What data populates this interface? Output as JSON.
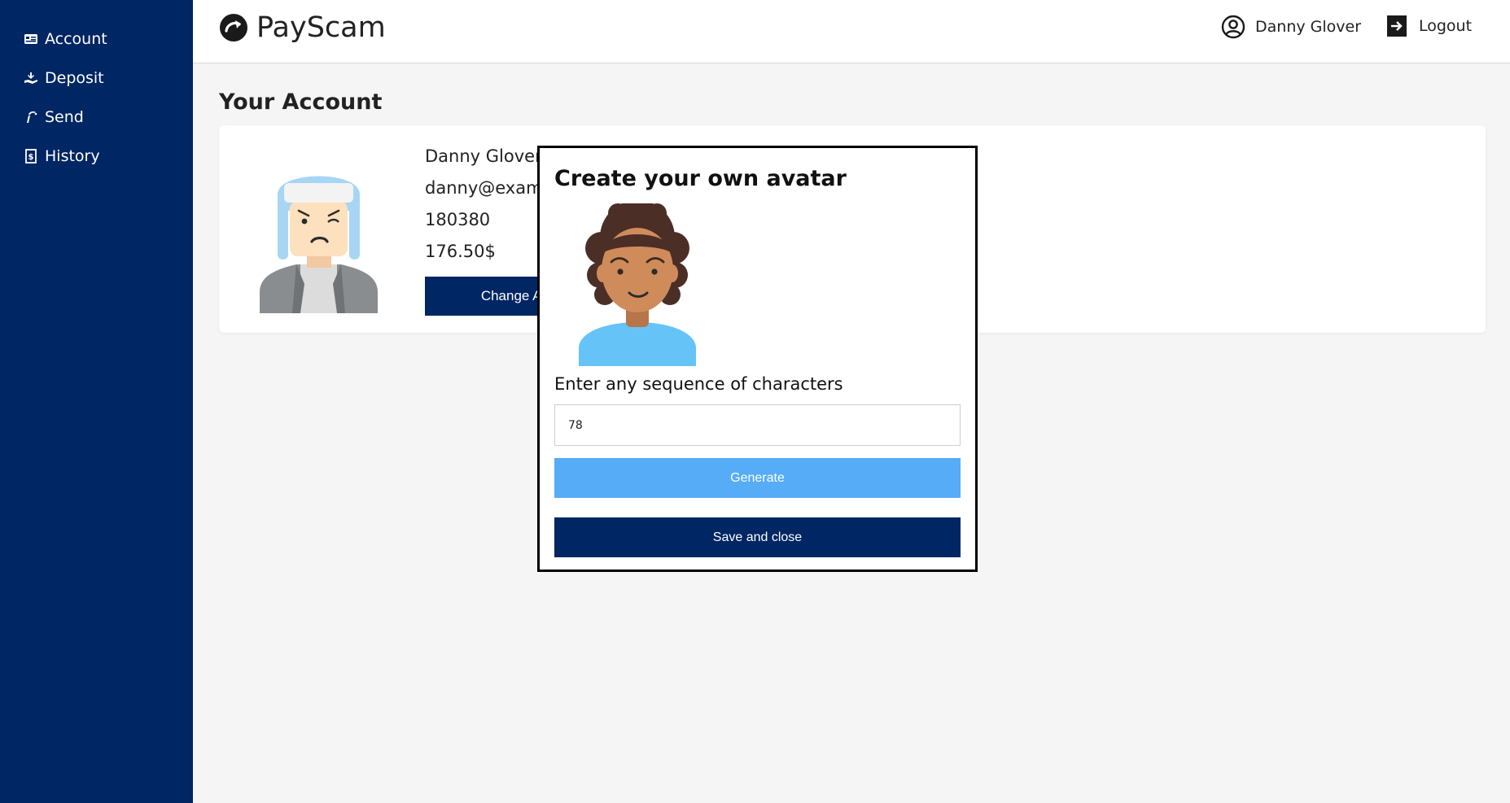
{
  "sidebar": {
    "items": [
      {
        "label": "Account",
        "icon": "id-card-icon"
      },
      {
        "label": "Deposit",
        "icon": "deposit-hand-icon"
      },
      {
        "label": "Send",
        "icon": "send-icon"
      },
      {
        "label": "History",
        "icon": "receipt-icon"
      }
    ]
  },
  "header": {
    "brand": "PayScam",
    "user_name": "Danny Glover",
    "logout_label": "Logout"
  },
  "main": {
    "title": "Your Account",
    "account": {
      "name": "Danny Glover",
      "email": "danny@exam",
      "account_number": "180380",
      "balance": "176.50$",
      "change_avatar_label": "Change Ava"
    }
  },
  "modal": {
    "title": "Create your own avatar",
    "input_label": "Enter any sequence of characters",
    "input_value": "78",
    "generate_label": "Generate",
    "save_label": "Save and close"
  },
  "colors": {
    "sidebar_bg": "#002663",
    "primary_button": "#002663",
    "generate_button": "#56acf7",
    "page_bg": "#f5f5f5"
  }
}
